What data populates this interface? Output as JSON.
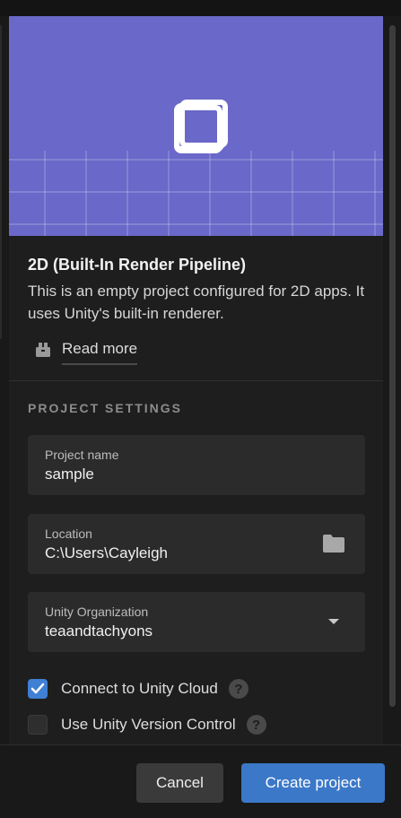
{
  "template": {
    "title": "2D (Built-In Render Pipeline)",
    "description": "This is an empty project configured for 2D apps. It uses Unity's built-in renderer.",
    "read_more_label": "Read more",
    "read_more_icon": "package-icon",
    "hero_color": "#6a68c9",
    "hero_icon": "2d-square-icon"
  },
  "settings": {
    "section_title": "PROJECT SETTINGS",
    "project_name": {
      "label": "Project name",
      "value": "sample"
    },
    "location": {
      "label": "Location",
      "value": "C:\\Users\\Cayleigh",
      "icon": "folder-icon"
    },
    "organization": {
      "label": "Unity Organization",
      "value": "teaandtachyons",
      "icon": "chevron-down-icon"
    },
    "connect_cloud": {
      "label": "Connect to Unity Cloud",
      "checked": true
    },
    "version_control": {
      "label": "Use Unity Version Control",
      "checked": false
    },
    "help_glyph": "?"
  },
  "footer": {
    "cancel_label": "Cancel",
    "create_label": "Create project"
  },
  "colors": {
    "accent": "#3b78c8",
    "checkbox_on": "#3f7fd4",
    "background": "#1e1e1e"
  }
}
